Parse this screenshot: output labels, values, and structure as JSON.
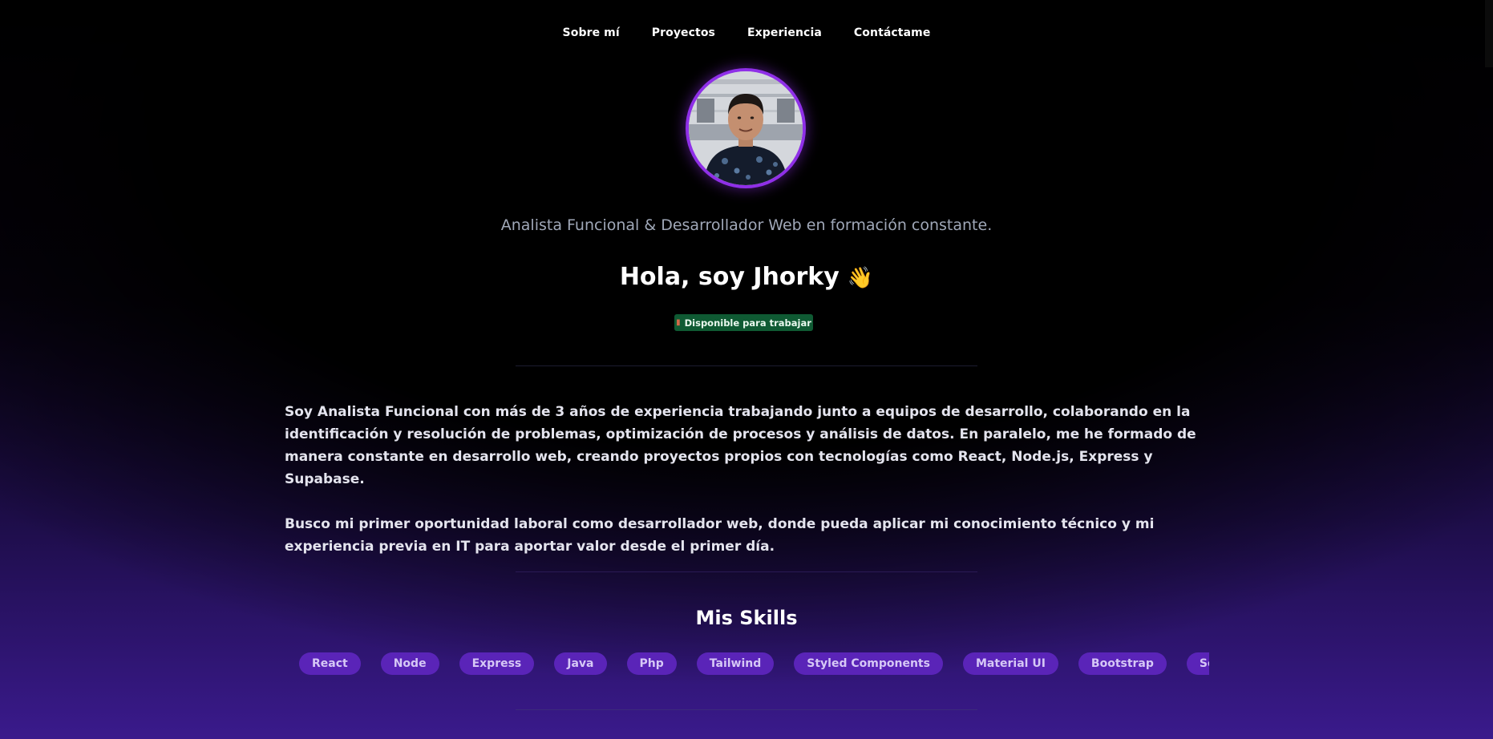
{
  "nav": {
    "items": [
      {
        "label": "Sobre mí"
      },
      {
        "label": "Proyectos"
      },
      {
        "label": "Experiencia"
      },
      {
        "label": "Contáctame"
      }
    ]
  },
  "hero": {
    "subtitle": "Analista Funcional & Desarrollador Web en formación constante.",
    "title": "Hola, soy Jhorky",
    "wave_icon": "👋",
    "badge_label": "Disponible para trabajar",
    "badge_icon": "briefcase-icon"
  },
  "about": {
    "paragraphs": [
      "Soy Analista Funcional con más de 3 años de experiencia trabajando junto a equipos de desarrollo, colaborando en la identificación y resolución de problemas, optimización de procesos y análisis de datos. En paralelo, me he formado de manera constante en desarrollo web, creando proyectos propios con tecnologías como React, Node.js, Express y Supabase.",
      "Busco mi primer oportunidad laboral como desarrollador web, donde pueda aplicar mi conocimiento técnico y mi experiencia previa en IT para aportar valor desde el primer día."
    ]
  },
  "skills": {
    "title": "Mis Skills",
    "items": [
      "React",
      "Node",
      "Express",
      "Java",
      "Php",
      "Tailwind",
      "Styled Components",
      "Material UI",
      "Bootstrap",
      "Sequelize"
    ]
  },
  "colors": {
    "accent": "#8f2fe8",
    "chip_bg": "#5a24b8",
    "badge_bg": "#0f5a33"
  }
}
